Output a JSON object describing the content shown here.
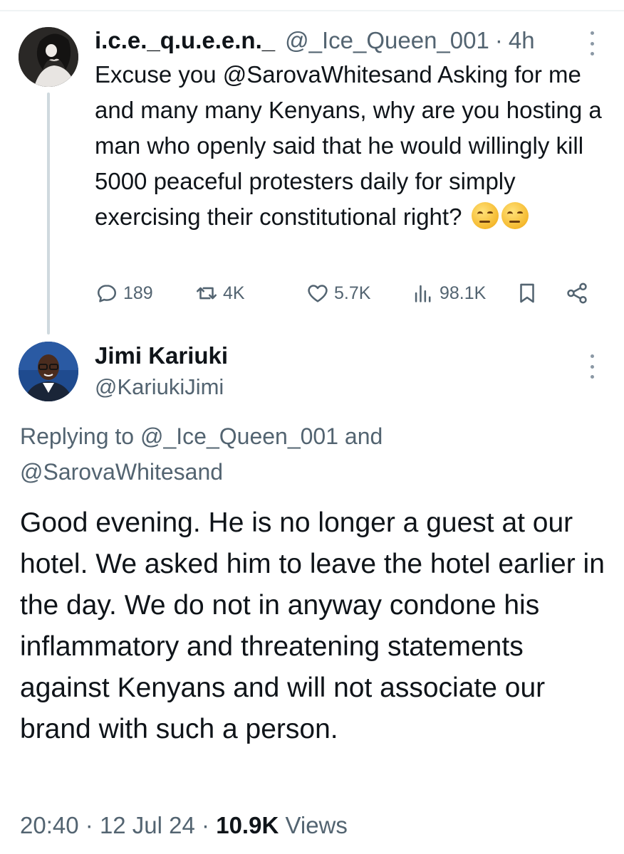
{
  "tweet1": {
    "name": "i.c.e._q.u.e.e.n._",
    "handle": "@_Ice_Queen_001",
    "separator": "·",
    "time": "4h",
    "text": "Excuse you @SarovaWhitesand Asking for me and many many Kenyans, why are you hosting a man who openly said that he would willingly kill 5000 peaceful protesters daily for simply exercising their constitutional right?",
    "emoji": [
      "unamused-face-emoji",
      "unamused-face-emoji"
    ],
    "stats": {
      "replies": "189",
      "reposts": "4K",
      "likes": "5.7K",
      "views": "98.1K"
    }
  },
  "tweet2": {
    "name": "Jimi Kariuki",
    "handle": "@KariukiJimi",
    "replying_prefix": "Replying to",
    "replying_to_1": "@_Ice_Queen_001",
    "replying_and": "and",
    "replying_to_2": "@SarovaWhitesand",
    "text": "Good evening. He is no longer a guest at our hotel. We asked him to leave the hotel earlier in the day. We do not in anyway condone his inflammatory and threatening statements against Kenyans and will not associate our brand with such a person.",
    "time": "20:40",
    "sep1": "·",
    "date": "12 Jul 24",
    "sep2": "·",
    "views_count": "10.9K",
    "views_label": "Views"
  },
  "icons": {
    "reply": "reply-icon",
    "retweet": "retweet-icon",
    "like": "heart-icon",
    "views": "analytics-icon",
    "bookmark": "bookmark-icon",
    "share": "share-icon",
    "more": "more-vertical-icon"
  },
  "colors": {
    "text": "#0f1419",
    "secondary": "#536471",
    "thread_line": "#cfd9de"
  }
}
